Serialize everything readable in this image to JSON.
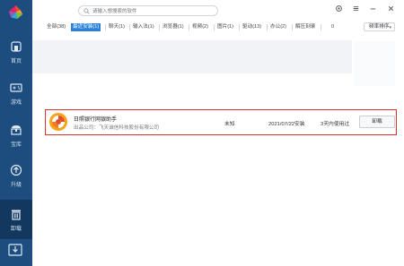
{
  "search": {
    "placeholder": "请输入想搜索的软件"
  },
  "sidebar": {
    "items": [
      {
        "label": "首页",
        "icon": "home-icon"
      },
      {
        "label": "游戏",
        "icon": "gamepad-icon"
      },
      {
        "label": "宝库",
        "icon": "treasure-icon"
      },
      {
        "label": "升级",
        "icon": "upgrade-icon"
      },
      {
        "label": "卸载",
        "icon": "trash-icon",
        "active": true
      }
    ]
  },
  "tabs": [
    {
      "label": "全部(38)"
    },
    {
      "label": "最近安装(1)",
      "active": true
    },
    {
      "label": "聊天(1)"
    },
    {
      "label": "输入法(1)"
    },
    {
      "label": "浏览器(1)"
    },
    {
      "label": "视频(2)"
    },
    {
      "label": "图片(1)"
    },
    {
      "label": "驱动(13)"
    },
    {
      "label": "办公(2)"
    },
    {
      "label": "解压刻录"
    },
    {
      "label": "0"
    }
  ],
  "sort": {
    "label": "频率排序"
  },
  "app": {
    "name": "日照银行网银助手",
    "publisher": "出品公司：飞天诚信科技股份有限公司",
    "category": "未知",
    "install_date": "2021/07/22安装",
    "last_used": "3天内使用过",
    "uninstall_label": "卸载"
  },
  "colors": {
    "sidebar": "#1c4d7e",
    "accent": "#2a82d8",
    "highlight_border": "#e0312e"
  }
}
